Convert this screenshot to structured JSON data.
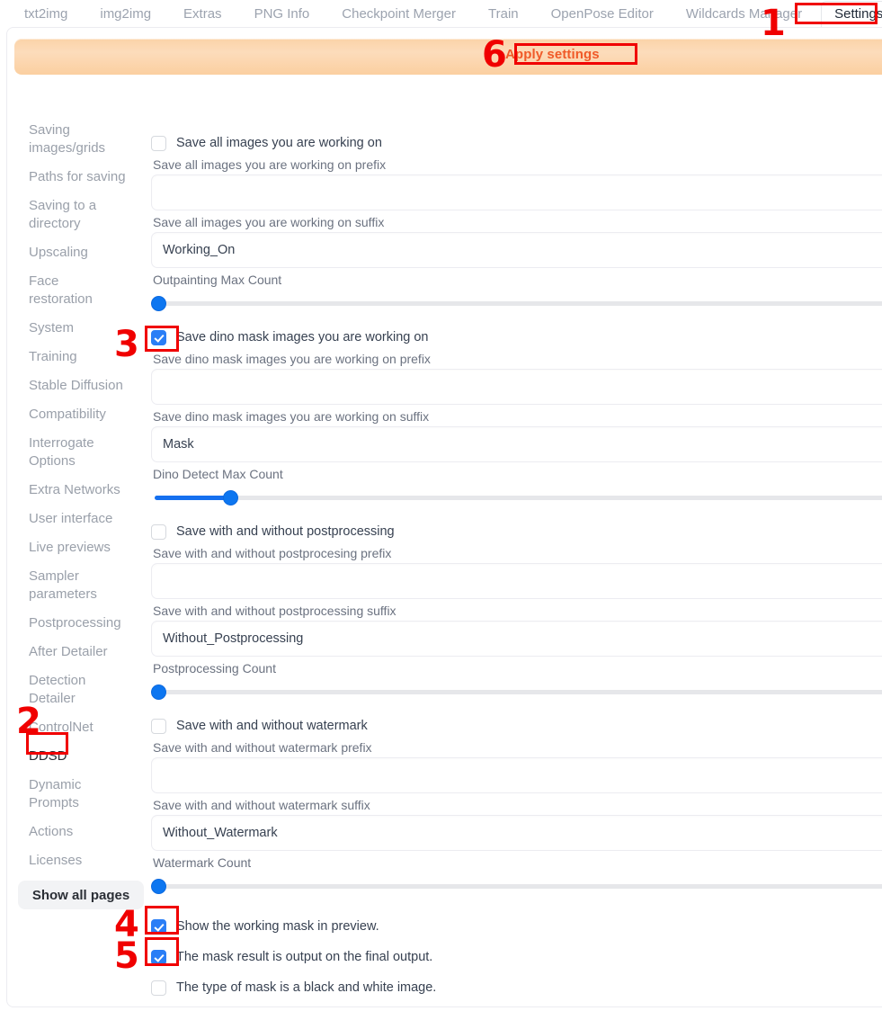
{
  "tabs": [
    {
      "label": "txt2img",
      "active": false
    },
    {
      "label": "img2img",
      "active": false
    },
    {
      "label": "Extras",
      "active": false
    },
    {
      "label": "PNG Info",
      "active": false
    },
    {
      "label": "Checkpoint Merger",
      "active": false
    },
    {
      "label": "Train",
      "active": false
    },
    {
      "label": "OpenPose Editor",
      "active": false
    },
    {
      "label": "Wildcards Manager",
      "active": false
    },
    {
      "label": "Settings",
      "active": true
    }
  ],
  "apply": {
    "label": "Apply settings"
  },
  "sidebar": {
    "items": [
      {
        "label": "Saving images/grids",
        "active": false
      },
      {
        "label": "Paths for saving",
        "active": false
      },
      {
        "label": "Saving to a directory",
        "active": false
      },
      {
        "label": "Upscaling",
        "active": false
      },
      {
        "label": "Face restoration",
        "active": false
      },
      {
        "label": "System",
        "active": false
      },
      {
        "label": "Training",
        "active": false
      },
      {
        "label": "Stable Diffusion",
        "active": false
      },
      {
        "label": "Compatibility",
        "active": false
      },
      {
        "label": "Interrogate Options",
        "active": false
      },
      {
        "label": "Extra Networks",
        "active": false
      },
      {
        "label": "User interface",
        "active": false
      },
      {
        "label": "Live previews",
        "active": false
      },
      {
        "label": "Sampler parameters",
        "active": false
      },
      {
        "label": "Postprocessing",
        "active": false
      },
      {
        "label": "After Detailer",
        "active": false
      },
      {
        "label": "Detection Detailer",
        "active": false
      },
      {
        "label": "ControlNet",
        "active": false
      },
      {
        "label": "DDSD",
        "active": true
      },
      {
        "label": "Dynamic Prompts",
        "active": false
      },
      {
        "label": "Actions",
        "active": false
      },
      {
        "label": "Licenses",
        "active": false
      }
    ],
    "show_all_pages": "Show all pages"
  },
  "groups": [
    {
      "checkbox_label": "Save all images you are working on",
      "checked": false,
      "prefix_label": "Save all images you are working on prefix",
      "prefix_value": "",
      "suffix_label": "Save all images you are working on suffix",
      "suffix_value": "Working_On",
      "slider_label": "Outpainting Max Count",
      "slider_percent": 0
    },
    {
      "checkbox_label": "Save dino mask images you are working on",
      "checked": true,
      "prefix_label": "Save dino mask images you are working on prefix",
      "prefix_value": "",
      "suffix_label": "Save dino mask images you are working on suffix",
      "suffix_value": "Mask",
      "slider_label": "Dino Detect Max Count",
      "slider_percent": 9
    },
    {
      "checkbox_label": "Save with and without postprocessing",
      "checked": false,
      "prefix_label": "Save with and without postprocesing prefix",
      "prefix_value": "",
      "suffix_label": "Save with and without postprocessing suffix",
      "suffix_value": "Without_Postprocessing",
      "slider_label": "Postprocessing Count",
      "slider_percent": 0
    },
    {
      "checkbox_label": "Save with and without watermark",
      "checked": false,
      "prefix_label": "Save with and without watermark prefix",
      "prefix_value": "",
      "suffix_label": "Save with and without watermark suffix",
      "suffix_value": "Without_Watermark",
      "slider_label": "Watermark Count",
      "slider_percent": 0
    }
  ],
  "bottom_checks": [
    {
      "label": "Show the working mask in preview.",
      "checked": true
    },
    {
      "label": "The mask result is output on the final output.",
      "checked": true
    },
    {
      "label": "The type of mask is a black and white image.",
      "checked": false
    }
  ],
  "annotations": {
    "color": "#f00000",
    "markers": [
      {
        "number": "1",
        "target": "settings-tab"
      },
      {
        "number": "2",
        "target": "sidebar-item-ddsd"
      },
      {
        "number": "3",
        "target": "save-dino-mask-checkbox"
      },
      {
        "number": "4",
        "target": "show-working-mask-checkbox"
      },
      {
        "number": "5",
        "target": "mask-result-final-output-checkbox"
      },
      {
        "number": "6",
        "target": "apply-settings-button"
      }
    ]
  }
}
